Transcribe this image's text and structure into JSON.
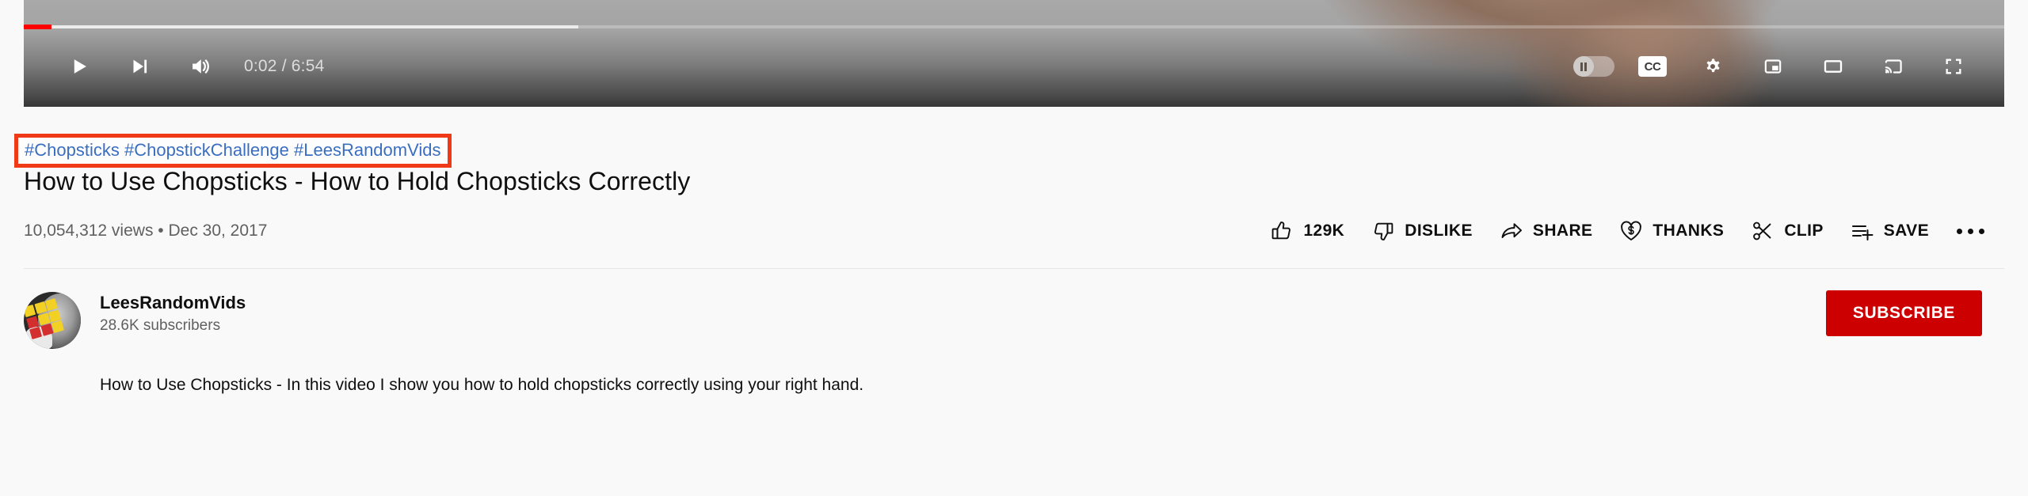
{
  "player": {
    "current_time": "0:02",
    "duration": "6:54",
    "time_display": "0:02 / 6:54",
    "progress_played_percent": 1.4,
    "progress_loaded_percent": 28,
    "play_label": "Play",
    "next_label": "Next",
    "volume_label": "Mute",
    "autoplay_label": "Autoplay is off",
    "captions_label": "CC",
    "settings_label": "Settings",
    "miniplayer_label": "Miniplayer",
    "theater_label": "Theater mode",
    "cast_label": "Play on TV",
    "fullscreen_label": "Full screen",
    "icons": {
      "play": "play-icon",
      "next": "next-track-icon",
      "volume": "volume-icon",
      "autoplay": "autoplay-toggle-icon",
      "captions": "closed-captions-icon",
      "settings": "gear-icon",
      "miniplayer": "miniplayer-icon",
      "theater": "theater-mode-icon",
      "cast": "cast-icon",
      "fullscreen": "fullscreen-icon"
    }
  },
  "video": {
    "hashtags": "#Chopsticks #ChopstickChallenge #LeesRandomVids",
    "hashtag_list": [
      "#Chopsticks",
      "#ChopstickChallenge",
      "#LeesRandomVids"
    ],
    "title": "How to Use Chopsticks - How to Hold Chopsticks Correctly",
    "views": "10,054,312 views",
    "separator": "•",
    "publish_date": "Dec 30, 2017",
    "meta_line": "10,054,312 views • Dec 30, 2017",
    "description": "How to Use Chopsticks - In this video I show you how to hold chopsticks correctly using your right hand."
  },
  "actions": [
    {
      "name": "like",
      "label": "129K",
      "icon": "thumbs-up-icon"
    },
    {
      "name": "dislike",
      "label": "DISLIKE",
      "icon": "thumbs-down-icon"
    },
    {
      "name": "share",
      "label": "SHARE",
      "icon": "share-arrow-icon"
    },
    {
      "name": "thanks",
      "label": "THANKS",
      "icon": "heart-dollar-icon"
    },
    {
      "name": "clip",
      "label": "CLIP",
      "icon": "scissors-icon"
    },
    {
      "name": "save",
      "label": "SAVE",
      "icon": "playlist-add-icon"
    }
  ],
  "more_actions_label": "More actions",
  "channel": {
    "name": "LeesRandomVids",
    "subscribers": "28.6K subscribers",
    "avatar_alt": "LeesRandomVids avatar",
    "subscribe_label": "SUBSCRIBE"
  },
  "annotation": {
    "type": "highlight-box",
    "target": "hashtags",
    "color": "#f03a17"
  },
  "colors": {
    "brand_red": "#cc0000",
    "annotation_red": "#f03a17",
    "link_blue": "#3a6ec0",
    "page_bg": "#f9f9f9",
    "primary_text": "#0f0f0f",
    "secondary_text": "#606060",
    "progress_red": "#ff0000"
  }
}
